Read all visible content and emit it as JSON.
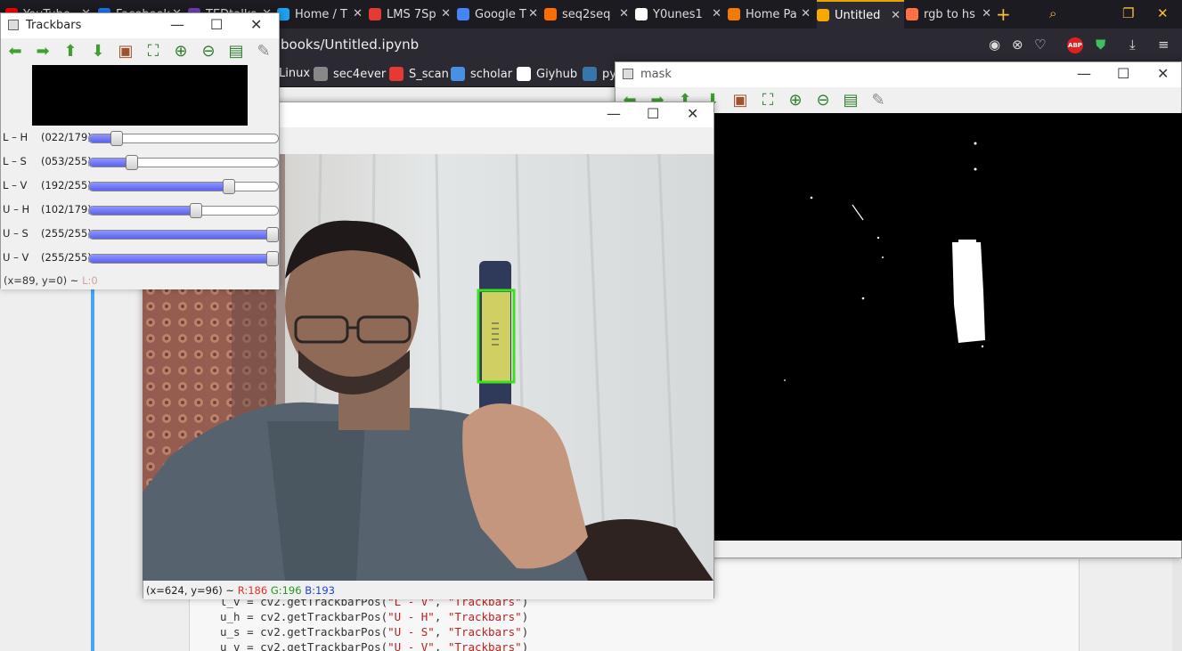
{
  "browser": {
    "tabs": [
      {
        "label": "YouTube",
        "color": "#ff0000"
      },
      {
        "label": "Facebook",
        "color": "#1877f2"
      },
      {
        "label": "TEDtalks",
        "color": "#6f3fb8"
      },
      {
        "label": "Home / T",
        "color": "#1da1f2"
      },
      {
        "label": "LMS 7Sp",
        "color": "#e53935"
      },
      {
        "label": "Google T",
        "color": "#4285f4"
      },
      {
        "label": "seq2seq",
        "color": "#ff6d00"
      },
      {
        "label": "Y0unes1",
        "color": "#ffffff"
      },
      {
        "label": "Home Pa",
        "color": "#f57c00"
      },
      {
        "label": "Untitled",
        "color": "#f6a900"
      },
      {
        "label": "rgb to hs",
        "color": "#ff7043"
      }
    ],
    "url_fragment": "books/Untitled.ipynb",
    "bookmarks": [
      {
        "label": "Linux",
        "color": "#555555"
      },
      {
        "label": "sec4ever",
        "color": "#888888"
      },
      {
        "label": "S_scan",
        "color": "#e53935"
      },
      {
        "label": "scholar",
        "color": "#4a90e2"
      },
      {
        "label": "Giyhub",
        "color": "#ffffff"
      },
      {
        "label": "py",
        "color": "#3776ab"
      }
    ],
    "abp_badge": "ABP"
  },
  "trackbars_window": {
    "title": "Trackbars",
    "rows": [
      {
        "label": "L – H",
        "value_text": "(022/179)",
        "fraction": 0.123
      },
      {
        "label": "L – S",
        "value_text": "(053/255)",
        "fraction": 0.208
      },
      {
        "label": "L – V",
        "value_text": "(192/255)",
        "fraction": 0.753
      },
      {
        "label": "U – H",
        "value_text": "(102/179)",
        "fraction": 0.57
      },
      {
        "label": "U – S",
        "value_text": "(255/255)",
        "fraction": 1.0
      },
      {
        "label": "U – V",
        "value_text": "(255/255)",
        "fraction": 1.0
      }
    ],
    "status": "(x=89, y=0) ~ ",
    "status_l": "L:0"
  },
  "frame_window": {
    "status_prefix": "(x=624, y=96) ~ ",
    "r": "R:186",
    "g": "G:196",
    "b": "B:193"
  },
  "mask_window": {
    "title": "mask"
  },
  "code_lines": [
    [
      "l_v = cv2.getTrackbarPos(",
      "\"L - V\"",
      ", ",
      "\"Trackbars\"",
      ")"
    ],
    [
      "u_h = cv2.getTrackbarPos(",
      "\"U - H\"",
      ", ",
      "\"Trackbars\"",
      ")"
    ],
    [
      "u_s = cv2.getTrackbarPos(",
      "\"U - S\"",
      ", ",
      "\"Trackbars\"",
      ")"
    ],
    [
      "u_v = cv2.getTrackbarPos(",
      "\"U - V\"",
      ", ",
      "\"Trackbars\"",
      ")"
    ]
  ],
  "colors": {
    "detect_box": "#39e21c",
    "trackbar_fill": "#6b72f2",
    "tab_accent": "#e8a400"
  }
}
